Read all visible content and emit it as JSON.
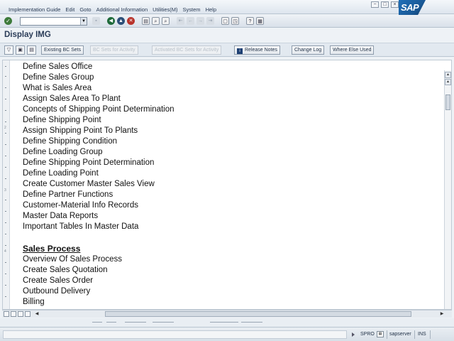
{
  "menu": {
    "items": [
      "Implementation Guide",
      "Edit",
      "Goto",
      "Additional Information",
      "Utilities(M)",
      "System",
      "Help"
    ]
  },
  "window_controls": [
    "−",
    "□",
    "×"
  ],
  "brand": {
    "logo_text": "SAP",
    "logo_color": "#1f6fb8"
  },
  "title": "Display IMG",
  "app_toolbar": {
    "buttons": [
      {
        "label": "Existing BC Sets",
        "enabled": true
      },
      {
        "label": "BC Sets for Activity",
        "enabled": false
      },
      {
        "label": "Activated BC Sets for Activity",
        "enabled": false
      },
      {
        "label": "Release Notes",
        "enabled": true
      },
      {
        "label": "Change Log",
        "enabled": true
      },
      {
        "label": "Where Else Used",
        "enabled": true
      }
    ]
  },
  "content": {
    "lines": [
      {
        "text": "Define Sales Office",
        "type": "item"
      },
      {
        "text": "Define Sales Group",
        "type": "item"
      },
      {
        "text": "What is Sales Area",
        "type": "item"
      },
      {
        "text": "Assign Sales Area To Plant",
        "type": "item"
      },
      {
        "text": "Concepts of Shipping Point Determination",
        "type": "item"
      },
      {
        "text": "Define Shipping Point",
        "type": "item"
      },
      {
        "text": "Assign Shipping Point To Plants",
        "type": "item"
      },
      {
        "text": "Define Shipping Condition",
        "type": "item"
      },
      {
        "text": "Define Loading Group",
        "type": "item"
      },
      {
        "text": "Define Shipping Point Determination",
        "type": "item"
      },
      {
        "text": "Define Loading Point",
        "type": "item"
      },
      {
        "text": "Create Customer Master Sales View",
        "type": "item"
      },
      {
        "text": "Define Partner Functions",
        "type": "item"
      },
      {
        "text": "Customer-Material Info Records",
        "type": "item"
      },
      {
        "text": "Master Data Reports",
        "type": "item"
      },
      {
        "text": "Important Tables In Master Data",
        "type": "item"
      },
      {
        "text": "",
        "type": "blank"
      },
      {
        "text": "Sales Process",
        "type": "heading"
      },
      {
        "text": "Overview Of Sales Process",
        "type": "item"
      },
      {
        "text": "Create Sales Quotation",
        "type": "item"
      },
      {
        "text": "Create Sales Order",
        "type": "item"
      },
      {
        "text": "Outbound Delivery",
        "type": "item"
      },
      {
        "text": "Billing",
        "type": "item"
      }
    ]
  },
  "status_bar": {
    "transaction": "SPRO",
    "server": "sapserver",
    "mode": "INS"
  }
}
